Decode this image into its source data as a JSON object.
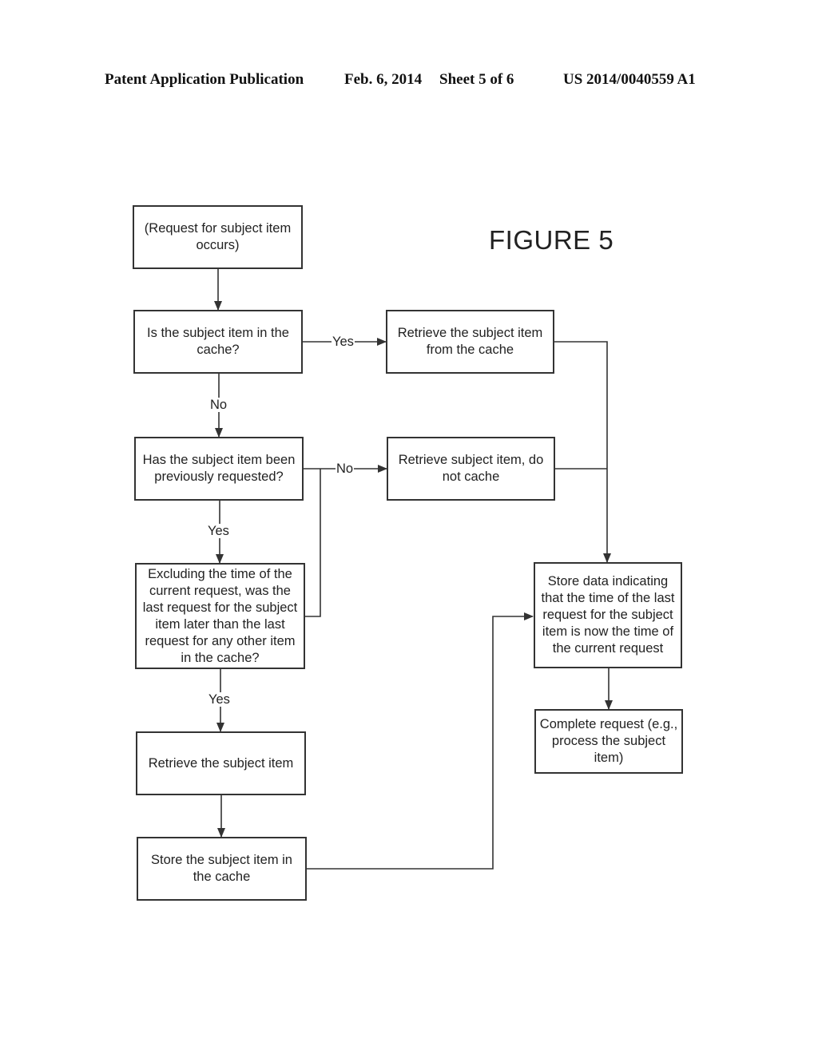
{
  "header": {
    "publication": "Patent Application Publication",
    "date": "Feb. 6, 2014",
    "sheet": "Sheet 5 of 6",
    "number": "US 2014/0040559 A1"
  },
  "figure": {
    "title": "FIGURE 5",
    "nodes": {
      "start": "(Request for subject item occurs)",
      "in_cache": "Is the subject item in the cache?",
      "retrieve_from_cache": "Retrieve the subject item from the cache",
      "previously_requested": "Has the subject item been previously requested?",
      "retrieve_no_cache": "Retrieve subject item, do not cache",
      "later_than_others": "Excluding the time of the current request, was the last request for the subject item later than the last request for any other item in the cache?",
      "store_time": "Store data indicating that the time of the last request for the subject item is now the time of the current request",
      "complete": "Complete request (e.g., process the subject item)",
      "retrieve_item": "Retrieve the subject item",
      "store_in_cache": "Store the subject item in the cache"
    },
    "edge_labels": {
      "in_cache_yes": "Yes",
      "in_cache_no": "No",
      "prev_no": "No",
      "prev_yes": "Yes",
      "later_yes": "Yes"
    }
  }
}
